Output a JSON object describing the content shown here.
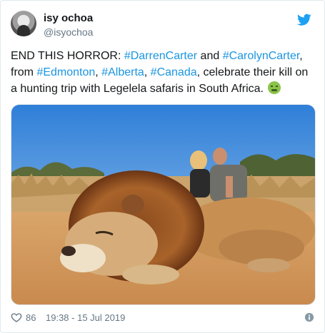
{
  "author": {
    "display_name": "isy ochoa",
    "handle": "@isyochoa"
  },
  "tweet": {
    "part1": "END THIS HORROR: ",
    "tag_darren": "#DarrenCarter",
    "part2": " and  ",
    "tag_carolyn": "#CarolynCarter",
    "part3": ", from ",
    "tag_edmonton": "#Edmonton",
    "part4": ", ",
    "tag_alberta": "#Alberta",
    "part5": ", ",
    "tag_canada": "#Canada",
    "part6": ", celebrate their kill on a hunting trip with Legelela safaris in South Africa. ",
    "emoji_icon": "nauseated-face-icon"
  },
  "footer": {
    "likes": "86",
    "timestamp": "19:38 - 15 Jul 2019"
  },
  "colors": {
    "hashtag": "#1b95e0",
    "twitter_blue": "#1da1f2",
    "secondary_text": "#657786"
  }
}
